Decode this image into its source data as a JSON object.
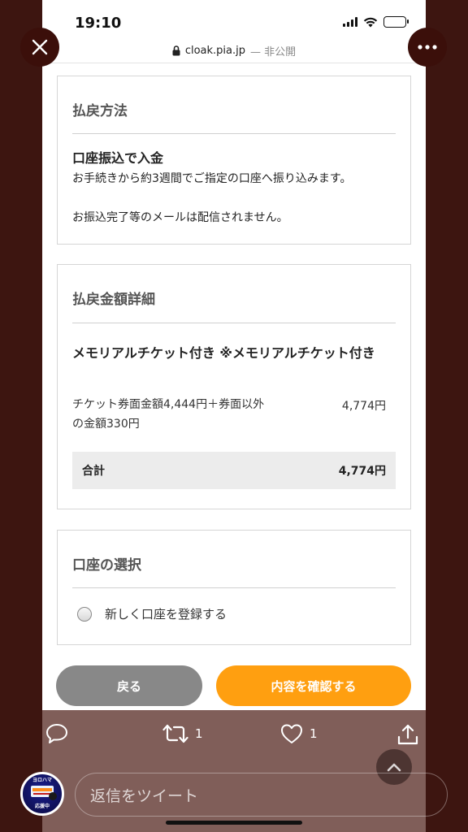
{
  "status": {
    "time": "19:10"
  },
  "url": {
    "domain": "cloak.pia.jp",
    "private_label": "— 非公開"
  },
  "refund_method": {
    "title": "払戻方法",
    "subtitle": "口座振込で入金",
    "line1": "お手続きから約3週間でご指定の口座へ振り込みます。",
    "line2": "お振込完了等のメールは配信されません。"
  },
  "refund_detail": {
    "title": "払戻金額詳細",
    "ticket_name": "メモリアルチケット付き ※メモリアルチケット付き",
    "price_desc": "チケット券面金額4,444円＋券面以外の金額330円",
    "price_value": "4,774円",
    "total_label": "合計",
    "total_value": "4,774円"
  },
  "account_select": {
    "title": "口座の選択",
    "option_new": "新しく口座を登録する"
  },
  "buttons": {
    "back": "戻る",
    "confirm": "内容を確認する"
  },
  "social": {
    "retweet_count": "1",
    "like_count": "1",
    "reply_placeholder": "返信をツイート"
  },
  "avatar_text": {
    "top": "ヨロハマ",
    "bottom": "応援中"
  },
  "colors": {
    "accent": "#ff9f10",
    "back_button": "#888888",
    "frame": "#3d1510"
  },
  "icons": [
    "close-icon",
    "more-icon",
    "lock-icon",
    "reply-icon",
    "retweet-icon",
    "like-icon",
    "share-icon",
    "chevron-up-icon"
  ]
}
